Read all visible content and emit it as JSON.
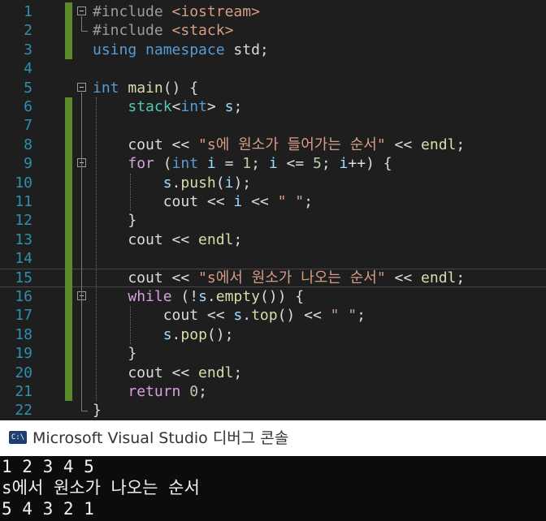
{
  "editor": {
    "line_numbers": [
      "1",
      "2",
      "3",
      "4",
      "5",
      "6",
      "7",
      "8",
      "9",
      "10",
      "11",
      "12",
      "13",
      "14",
      "15",
      "16",
      "17",
      "18",
      "19",
      "20",
      "21",
      "22"
    ],
    "lines": [
      [
        {
          "t": "#include ",
          "c": "pp"
        },
        {
          "t": "<iostream>",
          "c": "str"
        }
      ],
      [
        {
          "t": "#include ",
          "c": "pp"
        },
        {
          "t": "<stack>",
          "c": "str"
        }
      ],
      [
        {
          "t": "using",
          "c": "kw"
        },
        {
          "t": " "
        },
        {
          "t": "namespace",
          "c": "kw"
        },
        {
          "t": " std;"
        }
      ],
      [],
      [
        {
          "t": "int",
          "c": "kw"
        },
        {
          "t": " "
        },
        {
          "t": "main",
          "c": "fn"
        },
        {
          "t": "() {"
        }
      ],
      [
        {
          "t": "    "
        },
        {
          "t": "stack",
          "c": "ty"
        },
        {
          "t": "<"
        },
        {
          "t": "int",
          "c": "kw"
        },
        {
          "t": "> "
        },
        {
          "t": "s",
          "c": "var"
        },
        {
          "t": ";"
        }
      ],
      [],
      [
        {
          "t": "    cout << "
        },
        {
          "t": "\"s에 원소가 들어가는 순서\"",
          "c": "str"
        },
        {
          "t": " << "
        },
        {
          "t": "endl",
          "c": "fn"
        },
        {
          "t": ";"
        }
      ],
      [
        {
          "t": "    "
        },
        {
          "t": "for",
          "c": "ctl"
        },
        {
          "t": " ("
        },
        {
          "t": "int",
          "c": "kw"
        },
        {
          "t": " "
        },
        {
          "t": "i",
          "c": "var"
        },
        {
          "t": " = "
        },
        {
          "t": "1",
          "c": "num"
        },
        {
          "t": "; "
        },
        {
          "t": "i",
          "c": "var"
        },
        {
          "t": " <= "
        },
        {
          "t": "5",
          "c": "num"
        },
        {
          "t": "; "
        },
        {
          "t": "i",
          "c": "var"
        },
        {
          "t": "++) {"
        }
      ],
      [
        {
          "t": "        "
        },
        {
          "t": "s",
          "c": "var"
        },
        {
          "t": "."
        },
        {
          "t": "push",
          "c": "fn"
        },
        {
          "t": "("
        },
        {
          "t": "i",
          "c": "var"
        },
        {
          "t": ");"
        }
      ],
      [
        {
          "t": "        cout << "
        },
        {
          "t": "i",
          "c": "var"
        },
        {
          "t": " << "
        },
        {
          "t": "\" \"",
          "c": "str"
        },
        {
          "t": ";"
        }
      ],
      [
        {
          "t": "    }"
        }
      ],
      [
        {
          "t": "    cout << "
        },
        {
          "t": "endl",
          "c": "fn"
        },
        {
          "t": ";"
        }
      ],
      [],
      [
        {
          "t": "    cout << "
        },
        {
          "t": "\"s에서 원소가 나오는 순서\"",
          "c": "str"
        },
        {
          "t": " << "
        },
        {
          "t": "endl",
          "c": "fn"
        },
        {
          "t": ";"
        }
      ],
      [
        {
          "t": "    "
        },
        {
          "t": "while",
          "c": "ctl"
        },
        {
          "t": " (!"
        },
        {
          "t": "s",
          "c": "var"
        },
        {
          "t": "."
        },
        {
          "t": "empty",
          "c": "fn"
        },
        {
          "t": "()) {"
        }
      ],
      [
        {
          "t": "        cout << "
        },
        {
          "t": "s",
          "c": "var"
        },
        {
          "t": "."
        },
        {
          "t": "top",
          "c": "fn"
        },
        {
          "t": "() << "
        },
        {
          "t": "\" \"",
          "c": "str"
        },
        {
          "t": ";"
        }
      ],
      [
        {
          "t": "        "
        },
        {
          "t": "s",
          "c": "var"
        },
        {
          "t": "."
        },
        {
          "t": "pop",
          "c": "fn"
        },
        {
          "t": "();"
        }
      ],
      [
        {
          "t": "    }"
        }
      ],
      [
        {
          "t": "    cout << "
        },
        {
          "t": "endl",
          "c": "fn"
        },
        {
          "t": ";"
        }
      ],
      [
        {
          "t": "    "
        },
        {
          "t": "return",
          "c": "ctl"
        },
        {
          "t": " "
        },
        {
          "t": "0",
          "c": "num"
        },
        {
          "t": ";"
        }
      ],
      [
        {
          "t": "}"
        }
      ]
    ],
    "current_line": 15,
    "modified_lines": [
      1,
      2,
      3,
      6,
      7,
      8,
      9,
      10,
      11,
      12,
      13,
      14,
      15,
      16,
      17,
      18,
      19,
      20,
      21
    ],
    "fold_lines": [
      1,
      5,
      9,
      16
    ],
    "colors": {
      "background": "#1e1e1e",
      "line_number": "#2b91af",
      "keyword": "#569cd6",
      "control": "#d8a0df",
      "type": "#4ec9b0",
      "string": "#d69d85",
      "number": "#b5cea8",
      "variable": "#9cdcfe",
      "function": "#dcdcaa",
      "modified_bar": "#5a8a2c"
    }
  },
  "console": {
    "icon_label": "C:\\",
    "title": "Microsoft Visual Studio 디버그 콘솔",
    "output": [
      "1 2 3 4 5",
      "s에서 원소가 나오는 순서",
      "5 4 3 2 1"
    ]
  }
}
